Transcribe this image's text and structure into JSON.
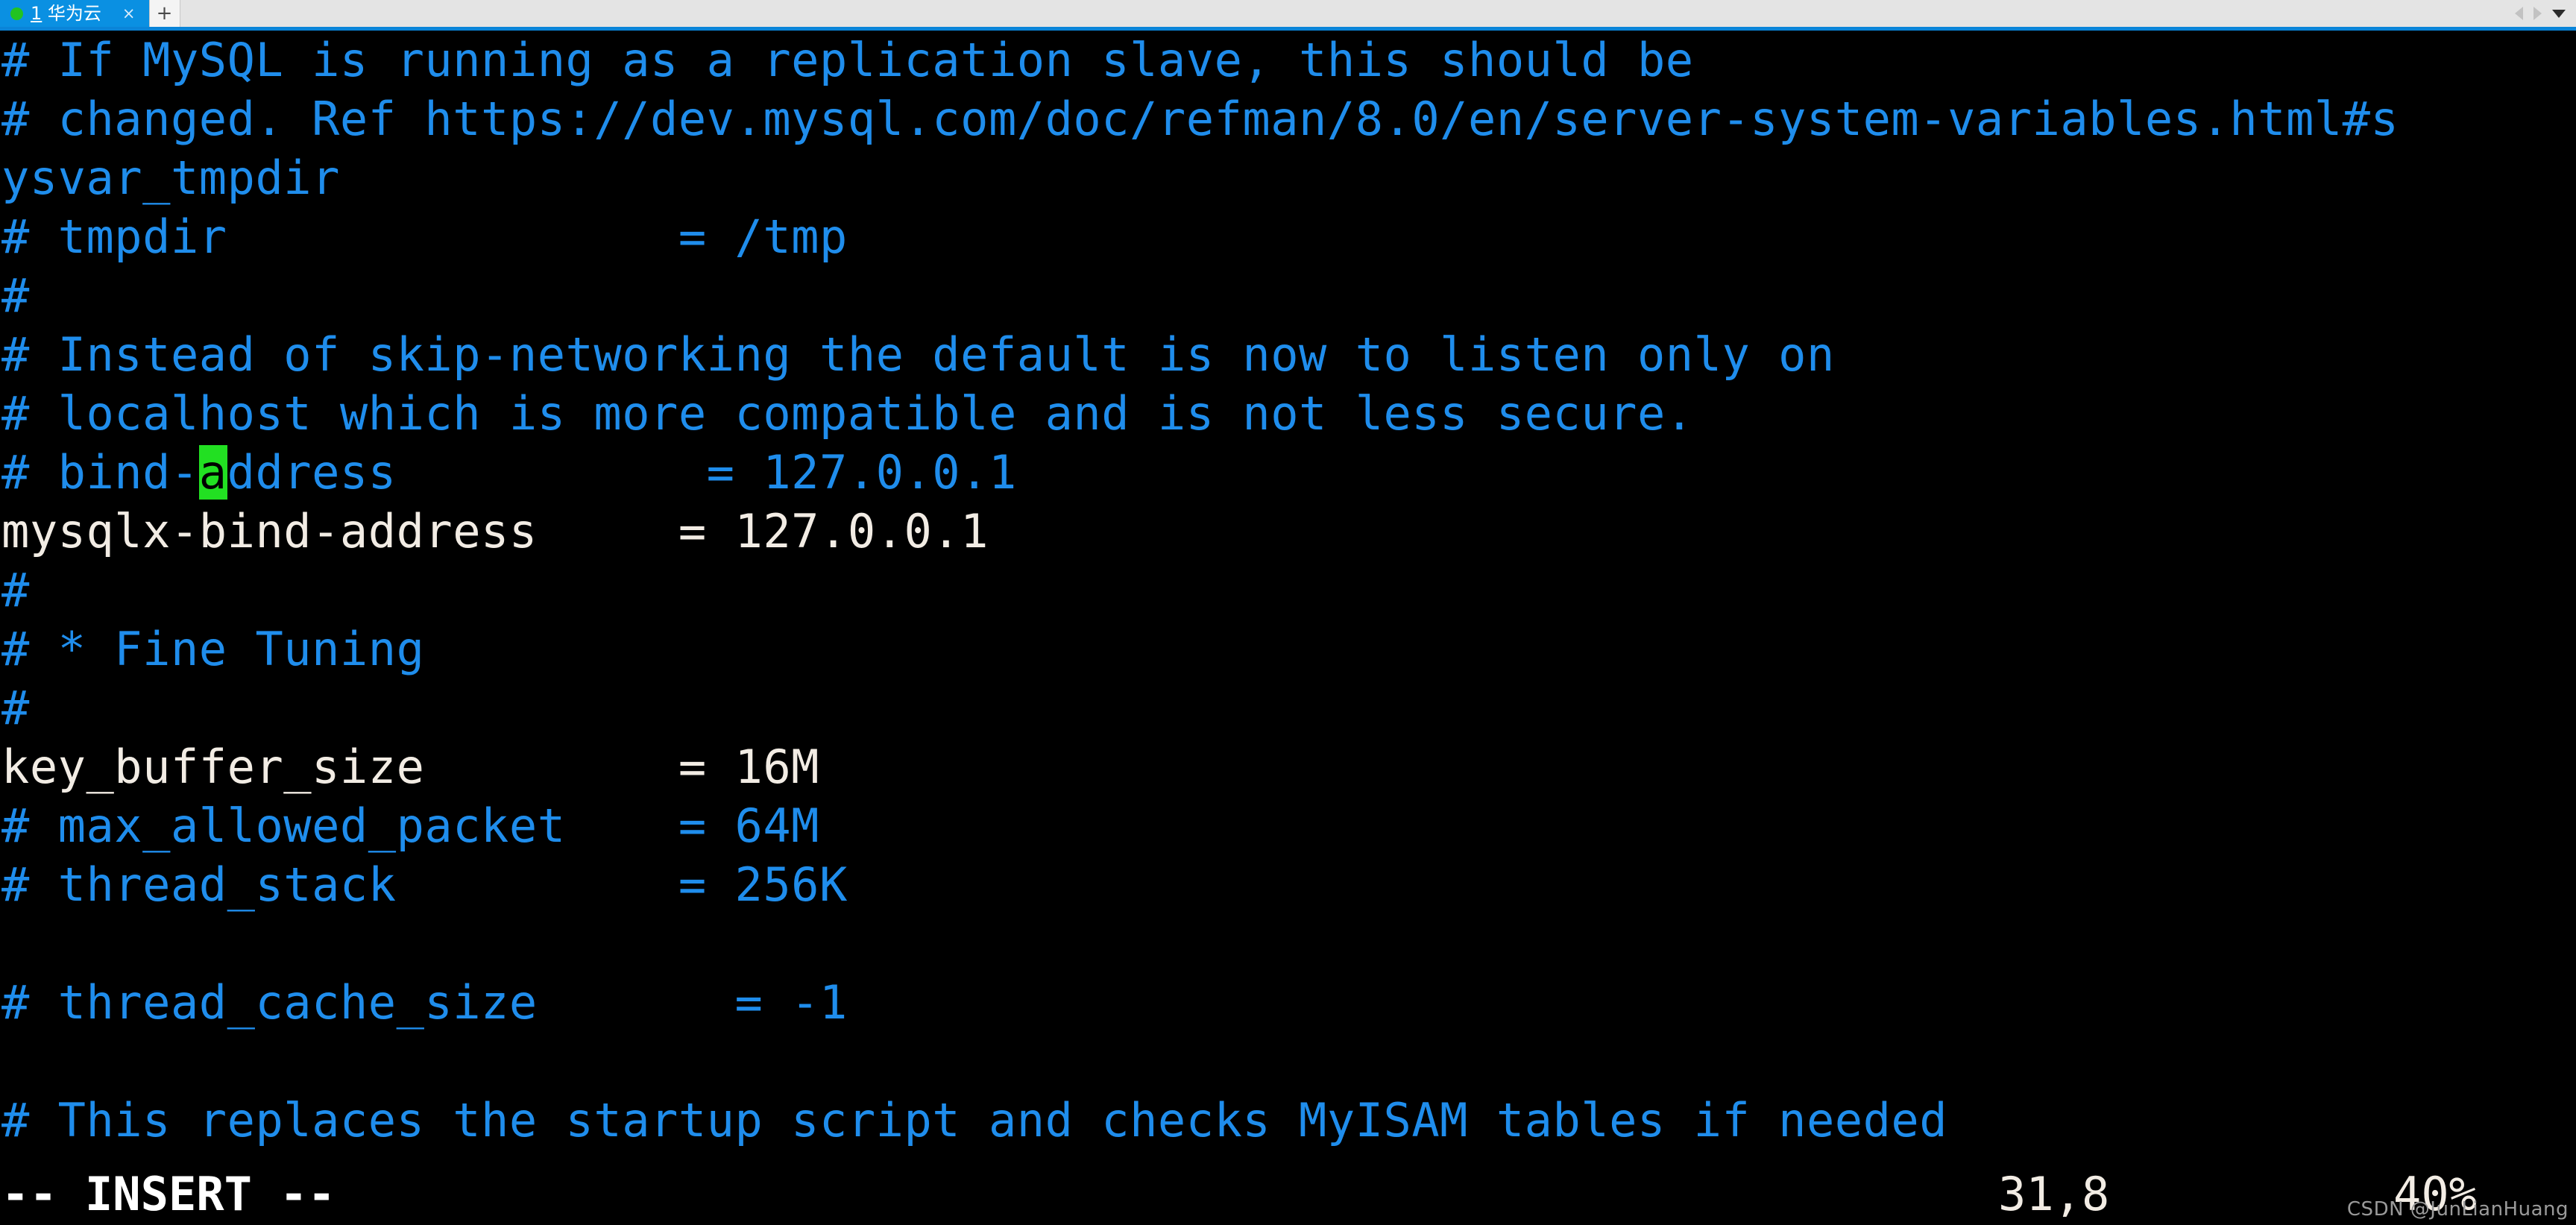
{
  "tabbar": {
    "tab": {
      "status_dot": "green",
      "number": "1",
      "label": " 华为云",
      "close_label": "×"
    },
    "new_tab_label": "+",
    "scroll_left_icon": "triangle-left-icon",
    "scroll_right_icon": "triangle-right-icon",
    "menu_icon": "chevron-down-icon"
  },
  "terminal": {
    "lines": [
      {
        "segments": [
          {
            "text": "# If MySQL is running as a replication slave, this should be",
            "cls": "c-comment"
          }
        ]
      },
      {
        "segments": [
          {
            "text": "# changed. Ref https://dev.mysql.com/doc/refman/8.0/en/server-system-variables.html#s",
            "cls": "c-comment"
          }
        ]
      },
      {
        "segments": [
          {
            "text": "ysvar_tmpdir",
            "cls": "c-comment"
          }
        ]
      },
      {
        "segments": [
          {
            "text": "# tmpdir                = /tmp",
            "cls": "c-comment"
          }
        ]
      },
      {
        "segments": [
          {
            "text": "#",
            "cls": "c-comment"
          }
        ]
      },
      {
        "segments": [
          {
            "text": "# Instead of skip-networking the default is now to listen only on",
            "cls": "c-comment"
          }
        ]
      },
      {
        "segments": [
          {
            "text": "# localhost which is more compatible and is not less secure.",
            "cls": "c-comment"
          }
        ]
      },
      {
        "segments": [
          {
            "text": "# bind-",
            "cls": "c-comment"
          },
          {
            "text": "a",
            "cls": "c-comment cursor"
          },
          {
            "text": "ddress           = 127.0.0.1",
            "cls": "c-comment"
          }
        ]
      },
      {
        "segments": [
          {
            "text": "mysqlx-bind-address     = 127.0.0.1",
            "cls": "c-normal"
          }
        ]
      },
      {
        "segments": [
          {
            "text": "#",
            "cls": "c-comment"
          }
        ]
      },
      {
        "segments": [
          {
            "text": "# * Fine Tuning",
            "cls": "c-comment"
          }
        ]
      },
      {
        "segments": [
          {
            "text": "#",
            "cls": "c-comment"
          }
        ]
      },
      {
        "segments": [
          {
            "text": "key_buffer_size         = 16M",
            "cls": "c-normal"
          }
        ]
      },
      {
        "segments": [
          {
            "text": "# max_allowed_packet    = 64M",
            "cls": "c-comment"
          }
        ]
      },
      {
        "segments": [
          {
            "text": "# thread_stack          = 256K",
            "cls": "c-comment"
          }
        ]
      },
      {
        "segments": [
          {
            "text": "",
            "cls": "c-comment"
          }
        ]
      },
      {
        "segments": [
          {
            "text": "# thread_cache_size       = -1",
            "cls": "c-comment"
          }
        ]
      },
      {
        "segments": [
          {
            "text": "",
            "cls": "c-comment"
          }
        ]
      },
      {
        "segments": [
          {
            "text": "# This replaces the startup script and checks MyISAM tables if needed",
            "cls": "c-comment"
          }
        ]
      }
    ]
  },
  "statusline": {
    "mode": "-- INSERT --",
    "position": "31,8",
    "percent": "40%"
  },
  "watermark": "CSDN @JunLianHuang",
  "colors": {
    "tab_active": "#0a90e2",
    "tab_underline": "#0a84d8",
    "tabbar_bg": "#e4e4e4",
    "status_dot": "#22c322",
    "terminal_bg": "#000000",
    "comment": "#1f8dec",
    "normal_text": "#f2ece4",
    "cursor_bg": "#22e022"
  }
}
